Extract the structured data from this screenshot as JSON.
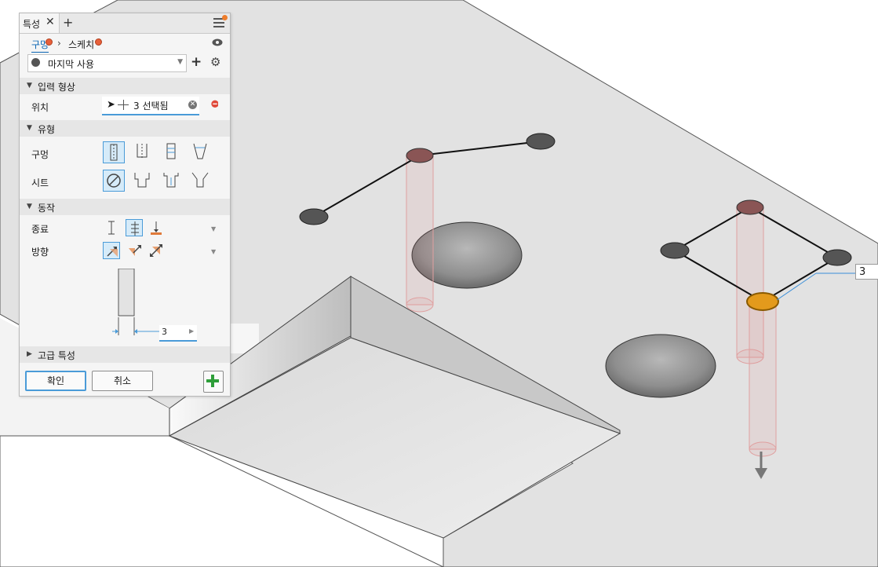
{
  "viewport": {
    "dimension_value": "3"
  },
  "panel": {
    "tab_title": "특성",
    "close_glyph": "✕",
    "add_glyph": "+",
    "breadcrumb": {
      "hole": "구멍",
      "separator": "›",
      "sketch": "스케치"
    },
    "preset": {
      "value": "마지막 사용"
    },
    "sections": {
      "input_geometry": "입력 형상",
      "type": "유형",
      "behavior": "동작",
      "advanced": "고급 특성"
    },
    "input_geometry": {
      "position_label": "위치",
      "position_value": "3 선택됨"
    },
    "type": {
      "hole_label": "구멍",
      "seat_label": "시트"
    },
    "behavior": {
      "termination_label": "종료",
      "direction_label": "방향",
      "depth_value": "3"
    },
    "buttons": {
      "ok": "확인",
      "cancel": "취소"
    },
    "colors": {
      "accent": "#4a9bd8",
      "link": "#0a65b3",
      "badge": "#e8603a",
      "plus_green": "#2e9e3a"
    }
  }
}
